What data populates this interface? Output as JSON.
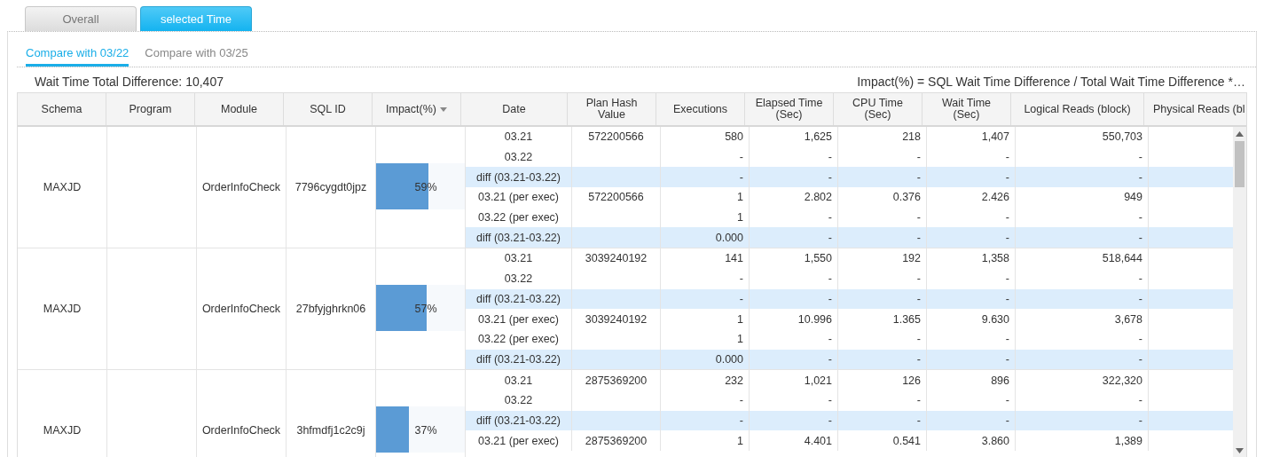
{
  "top_tabs": [
    {
      "label": "Overall",
      "selected": false
    },
    {
      "label": "selected Time",
      "selected": true
    }
  ],
  "sub_tabs": [
    {
      "label": "Compare with 03/22",
      "selected": true
    },
    {
      "label": "Compare with 03/25",
      "selected": false
    }
  ],
  "total_label": "Wait Time Total Difference: 10,407",
  "impact_note": "Impact(%) = SQL Wait Time Difference / Total Wait Time Difference *…",
  "table": {
    "columns": [
      {
        "label": "Schema"
      },
      {
        "label": "Program"
      },
      {
        "label": "Module"
      },
      {
        "label": "SQL ID"
      },
      {
        "label": "Impact(%)",
        "sorted": true
      },
      {
        "label": "Date"
      },
      {
        "label": "Plan Hash Value"
      },
      {
        "label": "Executions"
      },
      {
        "label": "Elapsed Time (Sec)"
      },
      {
        "label": "CPU Time (Sec)"
      },
      {
        "label": "Wait Time (Sec)"
      },
      {
        "label": "Logical Reads (block)"
      },
      {
        "label": "Physical Reads (bl"
      }
    ],
    "groups": [
      {
        "schema": "MAXJD",
        "module": "OrderInfoCheck",
        "sql_id": "7796cygdt0jpz",
        "impact": "59%",
        "level": 0.59,
        "rows": [
          {
            "kind": "normal",
            "date": "03.21",
            "plan_hash": "572200566",
            "executions": "580",
            "elapsed": "1,625",
            "cpu": "218",
            "wait": "1,407",
            "logical": "550,703"
          },
          {
            "kind": "normal",
            "date": "03.22",
            "executions": "-",
            "elapsed": "-",
            "cpu": "-",
            "wait": "-",
            "logical": "-"
          },
          {
            "kind": "diff",
            "date": "diff (03.21-03.22)",
            "executions": "-",
            "elapsed": "-",
            "cpu": "-",
            "wait": "-",
            "logical": "-"
          },
          {
            "kind": "normal",
            "date": "03.21 (per exec)",
            "plan_hash": "572200566",
            "executions": "1",
            "elapsed": "2.802",
            "cpu": "0.376",
            "wait": "2.426",
            "logical": "949"
          },
          {
            "kind": "normal",
            "date": "03.22 (per exec)",
            "executions": "1",
            "elapsed": "-",
            "cpu": "-",
            "wait": "-",
            "logical": "-"
          },
          {
            "kind": "diff",
            "date": "diff (03.21-03.22)",
            "executions": "0.000",
            "elapsed": "-",
            "cpu": "-",
            "wait": "-",
            "logical": "-"
          }
        ]
      },
      {
        "schema": "MAXJD",
        "module": "OrderInfoCheck",
        "sql_id": "27bfyjghrkn06",
        "impact": "57%",
        "level": 0.57,
        "rows": [
          {
            "kind": "normal",
            "date": "03.21",
            "plan_hash": "3039240192",
            "executions": "141",
            "elapsed": "1,550",
            "cpu": "192",
            "wait": "1,358",
            "logical": "518,644"
          },
          {
            "kind": "normal",
            "date": "03.22",
            "executions": "-",
            "elapsed": "-",
            "cpu": "-",
            "wait": "-",
            "logical": "-"
          },
          {
            "kind": "diff",
            "date": "diff (03.21-03.22)",
            "executions": "-",
            "elapsed": "-",
            "cpu": "-",
            "wait": "-",
            "logical": "-"
          },
          {
            "kind": "normal",
            "date": "03.21 (per exec)",
            "plan_hash": "3039240192",
            "executions": "1",
            "elapsed": "10.996",
            "cpu": "1.365",
            "wait": "9.630",
            "logical": "3,678"
          },
          {
            "kind": "normal",
            "date": "03.22 (per exec)",
            "executions": "1",
            "elapsed": "-",
            "cpu": "-",
            "wait": "-",
            "logical": "-"
          },
          {
            "kind": "diff",
            "date": "diff (03.21-03.22)",
            "executions": "0.000",
            "elapsed": "-",
            "cpu": "-",
            "wait": "-",
            "logical": "-"
          }
        ]
      },
      {
        "schema": "MAXJD",
        "module": "OrderInfoCheck",
        "sql_id": "3hfmdfj1c2c9j",
        "impact": "37%",
        "level": 0.37,
        "rows": [
          {
            "kind": "normal",
            "date": "03.21",
            "plan_hash": "2875369200",
            "executions": "232",
            "elapsed": "1,021",
            "cpu": "126",
            "wait": "896",
            "logical": "322,320"
          },
          {
            "kind": "normal",
            "date": "03.22",
            "executions": "-",
            "elapsed": "-",
            "cpu": "-",
            "wait": "-",
            "logical": "-"
          },
          {
            "kind": "diff",
            "date": "diff (03.21-03.22)",
            "executions": "-",
            "elapsed": "-",
            "cpu": "-",
            "wait": "-",
            "logical": "-"
          },
          {
            "kind": "normal",
            "date": "03.21 (per exec)",
            "plan_hash": "2875369200",
            "executions": "1",
            "elapsed": "4.401",
            "cpu": "0.541",
            "wait": "3.860",
            "logical": "1,389"
          }
        ]
      }
    ]
  }
}
